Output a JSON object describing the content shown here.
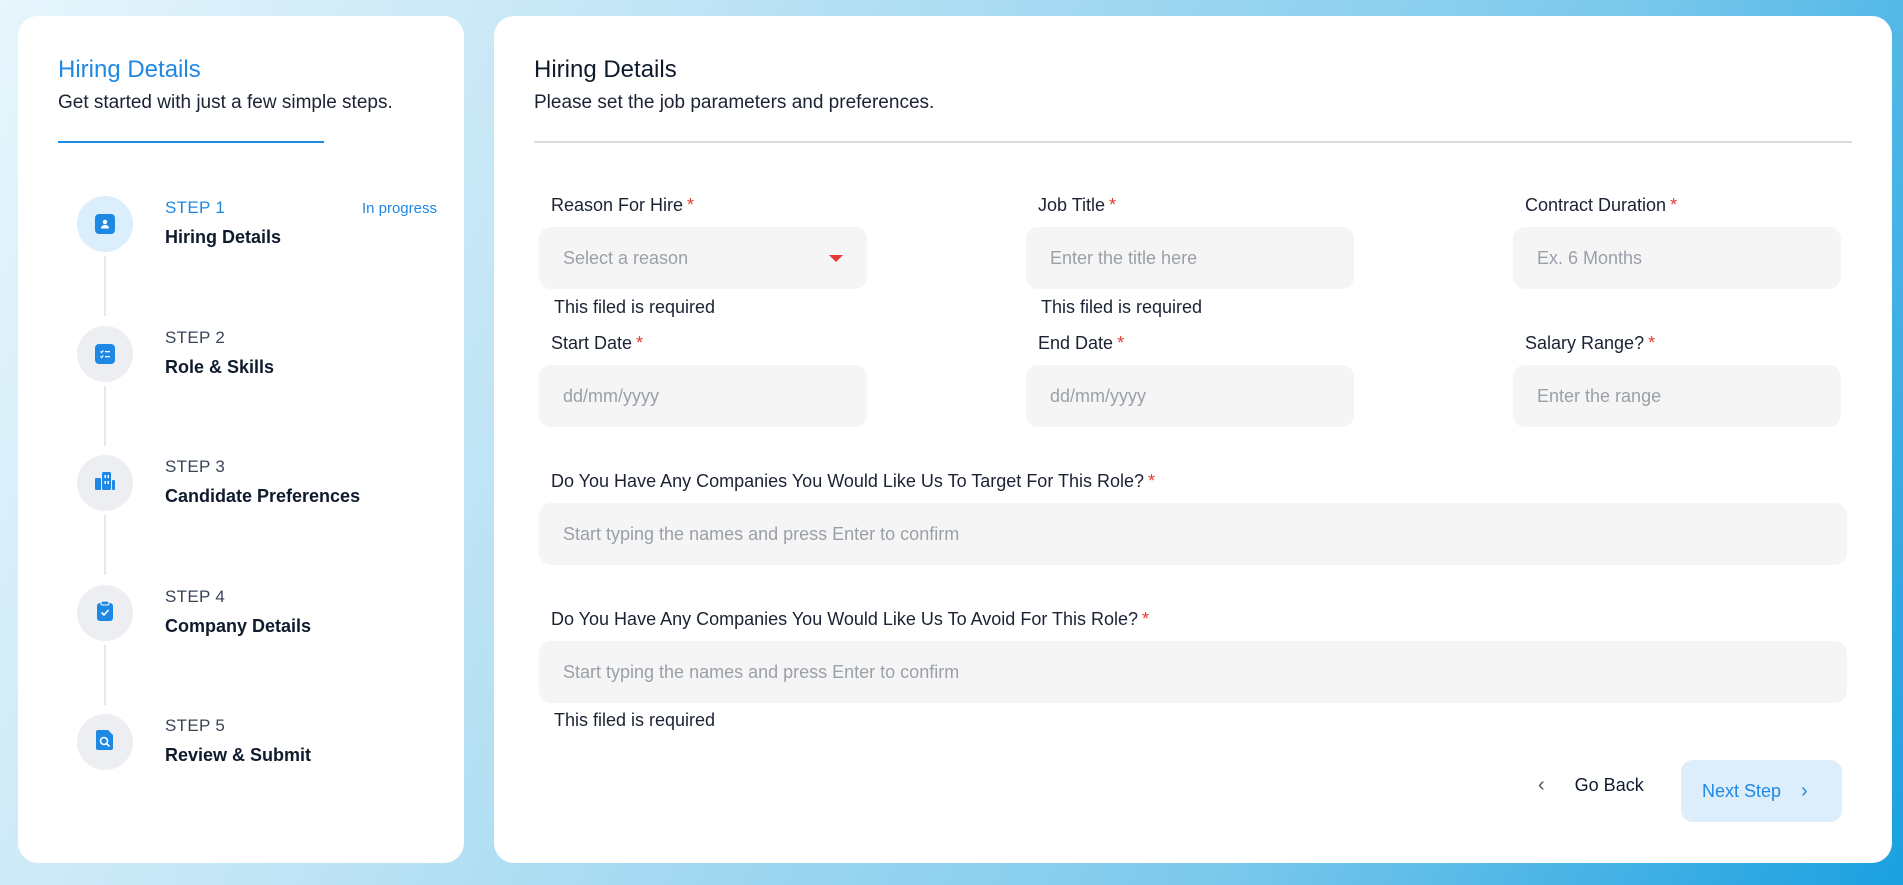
{
  "sidebar": {
    "title": "Hiring Details",
    "subtitle": "Get started with just a few simple steps.",
    "steps": [
      {
        "number": "STEP 1",
        "name": "Hiring Details",
        "status": "In progress",
        "icon": "person-icon"
      },
      {
        "number": "STEP 2",
        "name": "Role & Skills",
        "status": "",
        "icon": "checklist-icon"
      },
      {
        "number": "STEP 3",
        "name": "Candidate Preferences",
        "status": "",
        "icon": "building-icon"
      },
      {
        "number": "STEP 4",
        "name": "Company Details",
        "status": "",
        "icon": "clipboard-check-icon"
      },
      {
        "number": "STEP 5",
        "name": "Review & Submit",
        "status": "",
        "icon": "document-search-icon"
      }
    ]
  },
  "main": {
    "title": "Hiring Details",
    "subtitle": "Please set the job parameters and preferences.",
    "required_mark": "*",
    "fields": {
      "reason": {
        "label": "Reason For Hire",
        "placeholder": "Select a reason",
        "error": "This filed is required"
      },
      "job_title": {
        "label": "Job Title",
        "placeholder": "Enter the title here",
        "error": "This filed is required"
      },
      "contract": {
        "label": "Contract Duration",
        "placeholder": "Ex. 6 Months"
      },
      "start_date": {
        "label": "Start Date",
        "placeholder": "dd/mm/yyyy"
      },
      "end_date": {
        "label": "End Date",
        "placeholder": "dd/mm/yyyy"
      },
      "salary": {
        "label": "Salary Range?",
        "placeholder": "Enter the range"
      },
      "target": {
        "label": "Do You Have Any Companies You Would Like Us To Target For This Role?",
        "placeholder": "Start typing the names and press Enter to confirm"
      },
      "avoid": {
        "label": "Do You Have Any Companies You Would Like Us To Avoid For This Role?",
        "placeholder": "Start typing the names and press Enter to confirm",
        "error": "This filed is required"
      }
    },
    "buttons": {
      "back": "Go Back",
      "next": "Next Step"
    }
  },
  "colors": {
    "accent": "#1e88e5",
    "required": "#e53935",
    "input_bg": "#f5f5f6",
    "next_bg": "#dceefb"
  }
}
